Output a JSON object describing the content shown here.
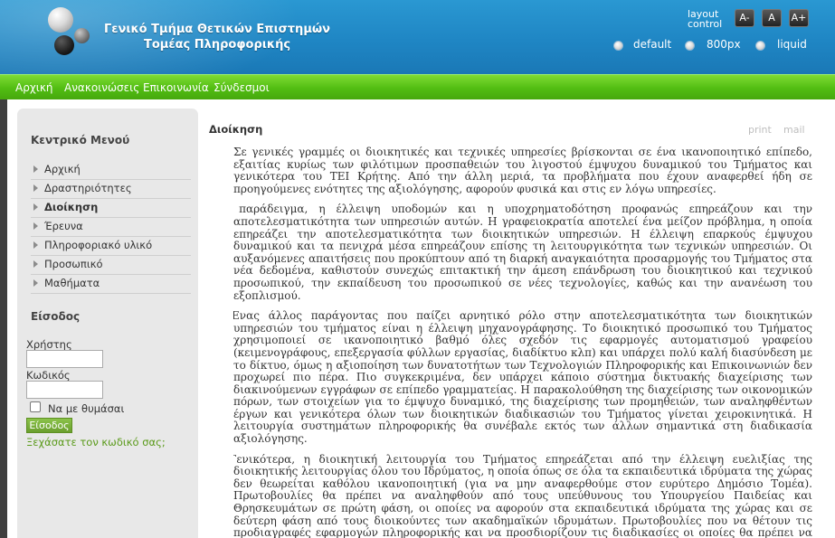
{
  "header": {
    "title_line1": "Γενικό Τμήμα Θετικών Επιστημών",
    "title_line2": "Τομέας Πληροφορικής",
    "layout_label_line1": "layout",
    "layout_label_line2": "control",
    "font_buttons": [
      "A-",
      "A",
      "A+"
    ],
    "layout_options": [
      "default",
      "800px",
      "liquid"
    ]
  },
  "nav": {
    "items": [
      "Αρχική",
      "Ανακοινώσεις",
      "Επικοινωνία",
      "Σύνδεσμοι"
    ]
  },
  "sidebar": {
    "menu_title": "Κεντρικό Μενού",
    "menu_items": [
      "Αρχική",
      "Δραστηριότητες",
      "Διοίκηση",
      "Έρευνα",
      "Πληροφοριακό υλικό",
      "Προσωπικό",
      "Μαθήματα"
    ],
    "login_title": "Είσοδος",
    "username_label": "Χρήστης",
    "password_label": "Κωδικός",
    "remember_label": "Να με θυμάσαι",
    "login_button": "Είσοδος",
    "forgot_link": "Ξεχάσατε τον κωδικό σας;"
  },
  "article": {
    "title": "Διοίκηση",
    "print_label": "print",
    "mail_label": "mail",
    "paragraphs": [
      "Σε γενικές γραμμές οι διοικητικές και τεχνικές υπηρεσίες βρίσκονται σε ένα ικανοποιητικό επίπεδο, εξαιτίας κυρίως των φιλότιμων προσπαθειών του λιγοστού έμψυχου δυναμικού του Τμήματος και γενικότερα του ΤΕΙ Κρήτης. Από την άλλη μεριά, τα προβλήματα που έχουν αναφερθεί ήδη σε προηγούμενες ενότητες της αξιολόγησης, αφορούν φυσικά και στις εν λόγω υπηρεσίες.",
      "Για παράδειγμα, η έλλειψη υποδομών και η υποχρηματοδότηση προφανώς επηρεάζουν και την αποτελεσματικότητα των υπηρεσιών αυτών. Η γραφειοκρατία αποτελεί ένα μείζον πρόβλημα, η οποία επηρεάζει την αποτελεσματικότητα των διοικητικών υπηρεσιών. Η έλλειψη επαρκούς έμψυχου δυναμικού και τα πενιχρά μέσα επηρεάζουν επίσης τη λειτουργικότητα των τεχνικών υπηρεσιών. Οι αυξανόμενες απαιτήσεις που προκύπτουν από τη διαρκή αναγκαιότητα προσαρμογής του Τμήματος στα νέα δεδομένα, καθιστούν συνεχώς επιτακτική την άμεση επάνδρωση του διοικητικού και τεχνικού προσωπικού, την εκπαίδευση του προσωπικού σε νέες τεχνολογίες, καθώς και την ανανέωση του εξοπλισμού.",
      "Ένας άλλος παράγοντας που παίζει αρνητικό ρόλο στην αποτελεσματικότητα των διοικητικών υπηρεσιών του τμήματος είναι η έλλειψη μηχανογράφησης. Το διοικητικό προσωπικό του Τμήματος χρησιμοποιεί σε ικανοποιητικό βαθμό όλες σχεδόν τις εφαρμογές αυτοματισμού γραφείου (κειμενογράφους, επεξεργασία φύλλων εργασίας, διαδίκτυο κλπ) και υπάρχει πολύ καλή διασύνδεση με το δίκτυο, όμως η αξιοποίηση των δυνατοτήτων των Τεχνολογιών Πληροφορικής και Επικοινωνιών δεν προχωρεί πιο πέρα. Πιο συγκεκριμένα, δεν υπάρχει κάποιο σύστημα δικτυακής διαχείρισης των διακινούμενων εγγράφων σε επίπεδο γραμματείας. Η παρακολούθηση της διαχείρισης των οικονομικών πόρων, των στοιχείων για το έμψυχο δυναμικό, της διαχείρισης των προμηθειών, των αναληφθέντων έργων και γενικότερα όλων των διοικητικών διαδικασιών του Τμήματος γίνεται χειροκινητικά. Η λειτουργία συστημάτων πληροφορικής θα συνέβαλε εκτός των άλλων σημαντικά στη διαδικασία αξιολόγησης.",
      "Γενικότερα, η διοικητική λειτουργία του Τμήματος επηρεάζεται από την έλλειψη ευελιξίας της διοικητικής λειτουργίας όλου του Ιδρύματος, η οποία όπως σε όλα τα εκπαιδευτικά ιδρύματα της χώρας δεν θεωρείται καθόλου ικανοποιητική (για να μην αναφερθούμε στον ευρύτερο Δημόσιο Τομέα). Πρωτοβουλίες θα πρέπει να αναληφθούν από τους υπεύθυνους του Υπουργείου Παιδείας και Θρησκευμάτων σε πρώτη φάση, οι οποίες να αφορούν στα εκπαιδευτικά ιδρύματα της χώρας και σε δεύτερη φάση από τους διοικούντες των ακαδημαϊκών ιδρυμάτων. Πρωτοβουλίες που να θέτουν τις προδιαγραφές εφαρμογών πληροφορικής και να προσδιορίζουν τις διαδικασίες οι οποίες θα πρέπει να αυτοματοποιηθούν."
    ]
  }
}
